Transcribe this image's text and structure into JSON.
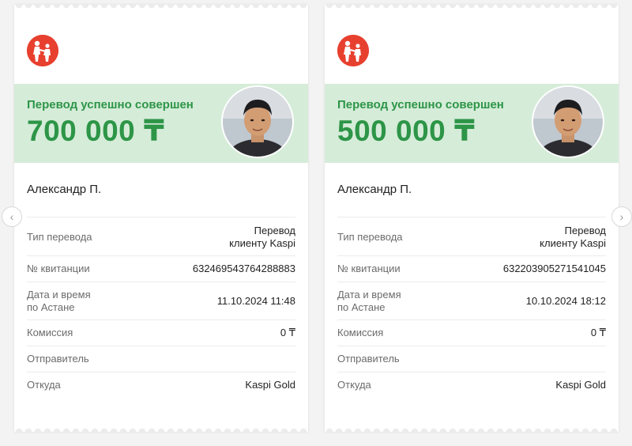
{
  "colors": {
    "accent_green": "#2d9547",
    "banner_bg": "#d5ecd9",
    "logo_red": "#e8402f"
  },
  "nav": {
    "prev_icon": "chevron-left-icon",
    "next_icon": "chevron-right-icon",
    "prev_glyph": "‹",
    "next_glyph": "›"
  },
  "receipts": [
    {
      "status": "Перевод успешно совершен",
      "amount": "700 000 ₸",
      "recipient": "Александр П.",
      "rows": [
        {
          "label": "Тип перевода",
          "value": "Перевод\nклиенту Kaspi"
        },
        {
          "label": "№ квитанции",
          "value": "632469543764288883"
        },
        {
          "label": "Дата и время\nпо Астане",
          "value": "11.10.2024 11:48"
        },
        {
          "label": "Комиссия",
          "value": "0 ₸"
        },
        {
          "label": "Отправитель",
          "value": ""
        },
        {
          "label": "Откуда",
          "value": "Kaspi Gold"
        }
      ]
    },
    {
      "status": "Перевод успешно совершен",
      "amount": "500 000 ₸",
      "recipient": "Александр П.",
      "rows": [
        {
          "label": "Тип перевода",
          "value": "Перевод\nклиенту Kaspi"
        },
        {
          "label": "№ квитанции",
          "value": "632203905271541045"
        },
        {
          "label": "Дата и время\nпо Астане",
          "value": "10.10.2024 18:12"
        },
        {
          "label": "Комиссия",
          "value": "0 ₸"
        },
        {
          "label": "Отправитель",
          "value": ""
        },
        {
          "label": "Откуда",
          "value": "Kaspi Gold"
        }
      ]
    }
  ]
}
